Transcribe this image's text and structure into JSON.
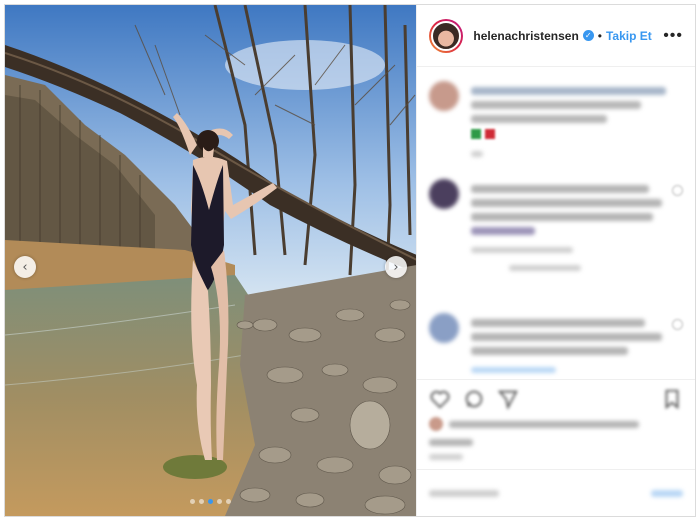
{
  "header": {
    "username": "helenachristensen",
    "separator": "•",
    "follow_label": "Takip Et",
    "more_label": "•••",
    "verified_glyph": "✓"
  },
  "carousel": {
    "prev_glyph": "‹",
    "next_glyph": "›",
    "total_slides": 5,
    "active_slide": 3
  },
  "icons": {
    "verified": "verified-badge-icon",
    "like": "heart-icon",
    "comment": "comment-icon",
    "share": "share-icon",
    "save": "bookmark-icon"
  },
  "colors": {
    "accent": "#3897f0",
    "border": "#dbdbdb",
    "text": "#262626"
  }
}
